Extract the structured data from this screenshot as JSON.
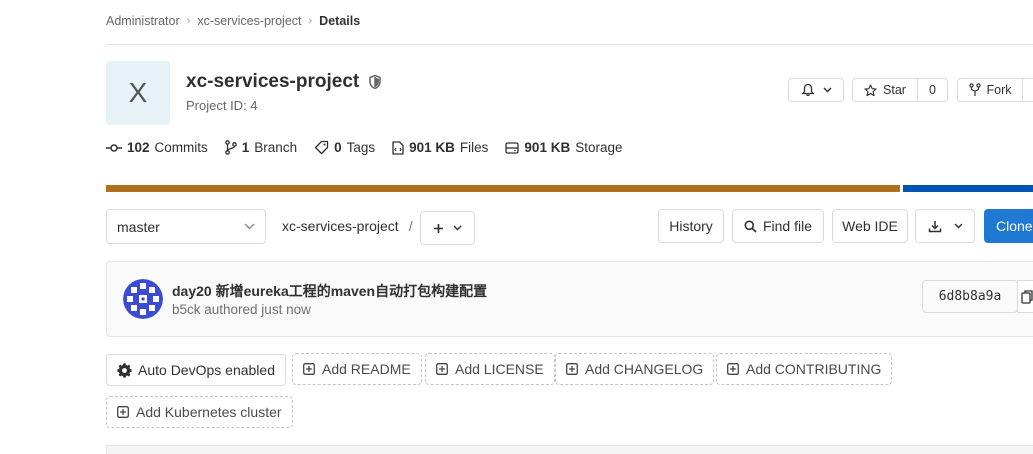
{
  "breadcrumb": {
    "items": [
      "Administrator",
      "xc-services-project",
      "Details"
    ]
  },
  "project": {
    "avatar_letter": "X",
    "name": "xc-services-project",
    "id_text": "Project ID: 4",
    "visibility_icon": "shield-icon"
  },
  "actions": {
    "notification_icon": "bell-icon",
    "star_label": "Star",
    "star_count": "0",
    "fork_label": "Fork"
  },
  "stats": {
    "commits_count": "102",
    "commits_label": "Commits",
    "branch_count": "1",
    "branch_label": "Branch",
    "tags_count": "0",
    "tags_label": "Tags",
    "files_size": "901 KB",
    "files_label": "Files",
    "storage_size": "901 KB",
    "storage_label": "Storage"
  },
  "language_bar": {
    "colors": [
      "#b07219",
      "#0055b3"
    ]
  },
  "repo_toolbar": {
    "branch": "master",
    "path_root": "xc-services-project",
    "path_separator": "/",
    "history_label": "History",
    "find_file_label": "Find file",
    "web_ide_label": "Web IDE",
    "clone_label": "Clone"
  },
  "last_commit": {
    "title": "day20 新增eureka工程的maven自动打包构建配置",
    "meta": "b5ck authored just now",
    "sha": "6d8b8a9a"
  },
  "quick_actions": {
    "auto_devops_label": "Auto DevOps enabled",
    "add_readme_label": "Add README",
    "add_license_label": "Add LICENSE",
    "add_changelog_label": "Add CHANGELOG",
    "add_contributing_label": "Add CONTRIBUTING",
    "add_kubernetes_label": "Add Kubernetes cluster"
  },
  "colors": {
    "primary": "#1f78d1",
    "avatar_bg": "#e6f2f5",
    "commit_avatar": "#3a4bd6"
  }
}
